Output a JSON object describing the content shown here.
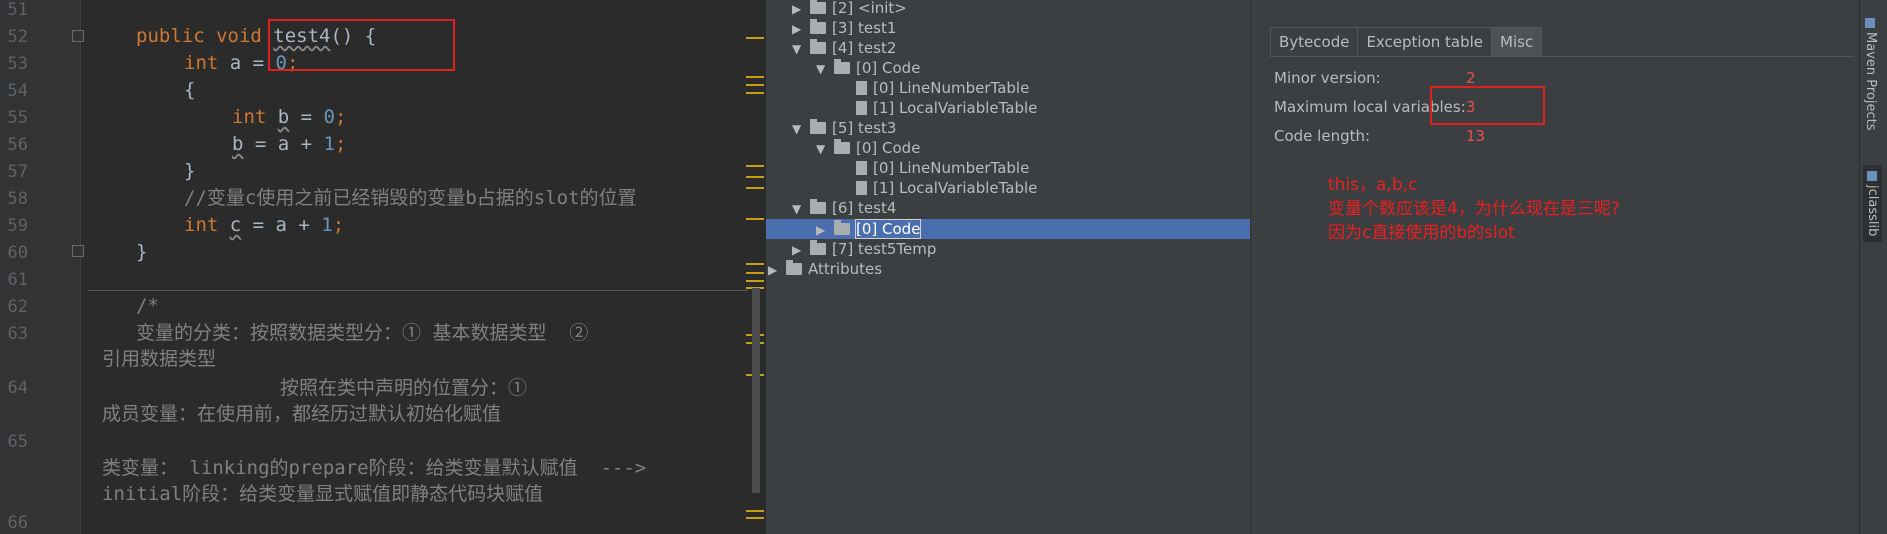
{
  "editor": {
    "line_numbers": [
      "51",
      "52",
      "53",
      "54",
      "55",
      "56",
      "57",
      "58",
      "59",
      "60",
      "61",
      "62",
      "63",
      "64",
      "65",
      "66"
    ],
    "code": {
      "l52_kw": "public void ",
      "l52_name": "test4",
      "l52_rest": "() {",
      "l53_kw": "int ",
      "l53_var": "a",
      "l53_eq": " = ",
      "l53_num": "0",
      "l53_end": ";",
      "l54": "{",
      "l55_kw": "int ",
      "l55_var": "b",
      "l55_eq": " = ",
      "l55_num": "0",
      "l55_end": ";",
      "l56_var": "b",
      "l56_mid": " = a + ",
      "l56_num": "1",
      "l56_end": ";",
      "l57": "}",
      "l58_comment": "//变量c使用之前已经销毁的变量b占据的slot的位置",
      "l59_kw": "int ",
      "l59_var": "c",
      "l59_mid": " = a + ",
      "l59_num": "1",
      "l59_end": ";",
      "l60": "}",
      "l62": "/*",
      "l63a": "变量的分类：按照数据类型分：① 基本数据类型  ②",
      "l63b": "引用数据类型",
      "l64a": "按照在类中声明的位置分：①",
      "l64b": "成员变量：在使用前，都经历过默认初始化赋值",
      "l65a": "类变量： linking的prepare阶段：给类变量默认赋值  --->",
      "l65b": "initial阶段：给类变量显式赋值即静态代码块赋值"
    }
  },
  "tree": {
    "nodes": [
      {
        "label": "[2] <init>"
      },
      {
        "label": "[3] test1"
      },
      {
        "label": "[4] test2"
      },
      {
        "label": "[0] Code"
      },
      {
        "label": "[0] LineNumberTable"
      },
      {
        "label": "[1] LocalVariableTable"
      },
      {
        "label": "[5] test3"
      },
      {
        "label": "[0] Code"
      },
      {
        "label": "[0] LineNumberTable"
      },
      {
        "label": "[1] LocalVariableTable"
      },
      {
        "label": "[6] test4"
      },
      {
        "label": "[0] Code"
      },
      {
        "label": "[7] test5Temp"
      },
      {
        "label": "Attributes"
      }
    ],
    "arrow_right": "▶",
    "arrow_down": "▼"
  },
  "misc": {
    "tabs": [
      "Bytecode",
      "Exception table",
      "Misc"
    ],
    "rows": [
      {
        "label": "Minor version:",
        "value": "2"
      },
      {
        "label": "Maximum local variables:",
        "value": "3"
      },
      {
        "label": "Code length:",
        "value": "13"
      }
    ],
    "notes": [
      "this，a,b,c",
      "变量个数应该是4，为什么现在是三呢?",
      "因为c直接使用的b的slot"
    ]
  },
  "right_strip": {
    "maven": "Maven Projects",
    "jclasslib": "jclasslib"
  },
  "colors": {
    "keyword": "#cc7832",
    "number": "#6897bb",
    "comment": "#808080",
    "annotation_red": "#ec1e1e",
    "selection": "#4b6eaf"
  }
}
